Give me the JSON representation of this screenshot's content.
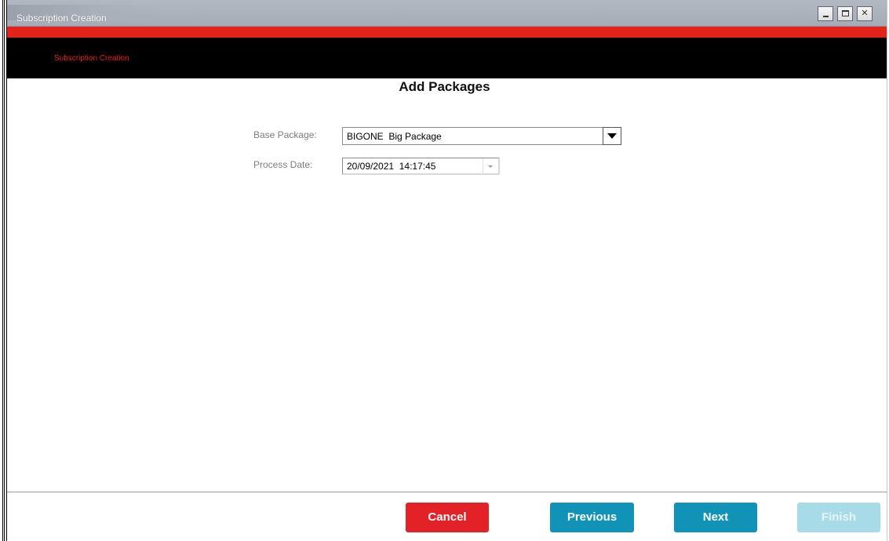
{
  "window": {
    "title": "Subscription Creation",
    "controls": [
      "minimize-icon",
      "maximize-icon",
      "close-icon"
    ],
    "close_glyph": "✕"
  },
  "header": {
    "label": "Subscription Creation"
  },
  "page": {
    "title": "Add Packages"
  },
  "form": {
    "base_package": {
      "label": "Base Package:",
      "value": "BIGONE  Big Package"
    },
    "process_date": {
      "label": "Process Date:",
      "value": "20/09/2021  14:17:45"
    }
  },
  "footer": {
    "cancel_label": "Cancel",
    "previous_label": "Previous",
    "next_label": "Next",
    "finish_label": "Finish"
  },
  "colors": {
    "brand_red": "#e32219",
    "primary_blue": "#1093b6",
    "disabled_blue": "#a8dbe8",
    "header_black": "#000000"
  }
}
